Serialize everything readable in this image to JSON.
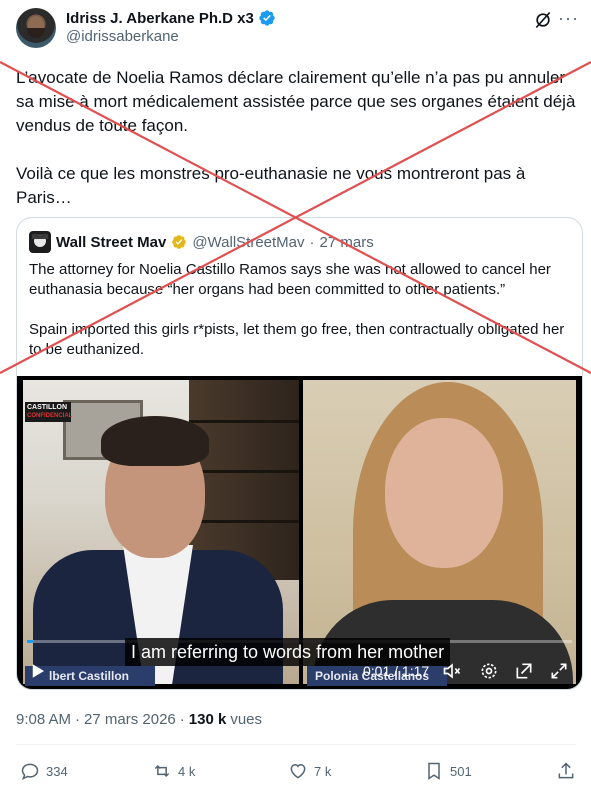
{
  "author": {
    "name": "Idriss J. Aberkane Ph.D x3",
    "handle": "@idrissaberkane"
  },
  "tweet": {
    "text": "L’avocate de Noelia Ramos déclare clairement qu’elle n’a pas pu annuler sa mise à mort médicalement assistée parce que ses organes étaient déjà vendus de toute façon.\n\nVoilà ce que les monstres pro-euthanasie ne vous montreront pas à Paris…"
  },
  "quoted": {
    "name": "Wall Street Mav",
    "handle": "@WallStreetMav",
    "separator": "·",
    "date": "27 mars",
    "text": "The attorney for Noelia Castillo Ramos says she was not allowed to cancel her euthanasia because “her organs had been committed to other patients.”\n\nSpain imported this girls r*pists, let them go free, then contractually obligated her to be euthanized."
  },
  "video": {
    "badge_line1": "CASTILLON",
    "badge_line2": "CONFIDENCIAL",
    "subtitle": "I am referring to words from her mother",
    "nameplate_left": "lbert Castillon",
    "nameplate_right": "Polonia Castellanos",
    "time": "0:01 / 1:17",
    "progress_fraction": 0.013
  },
  "meta": {
    "time": "9:08 AM",
    "separator": "·",
    "date": "27 mars 2026",
    "separator2": "·",
    "views_count": "130 k",
    "views_label": "vues"
  },
  "actions": {
    "replies": "334",
    "reposts": "4 k",
    "likes": "7 k",
    "bookmarks": "501"
  },
  "colors": {
    "accent": "#1d9bf0",
    "cross": "#e05050",
    "nameplate": "#2b3d6b"
  }
}
